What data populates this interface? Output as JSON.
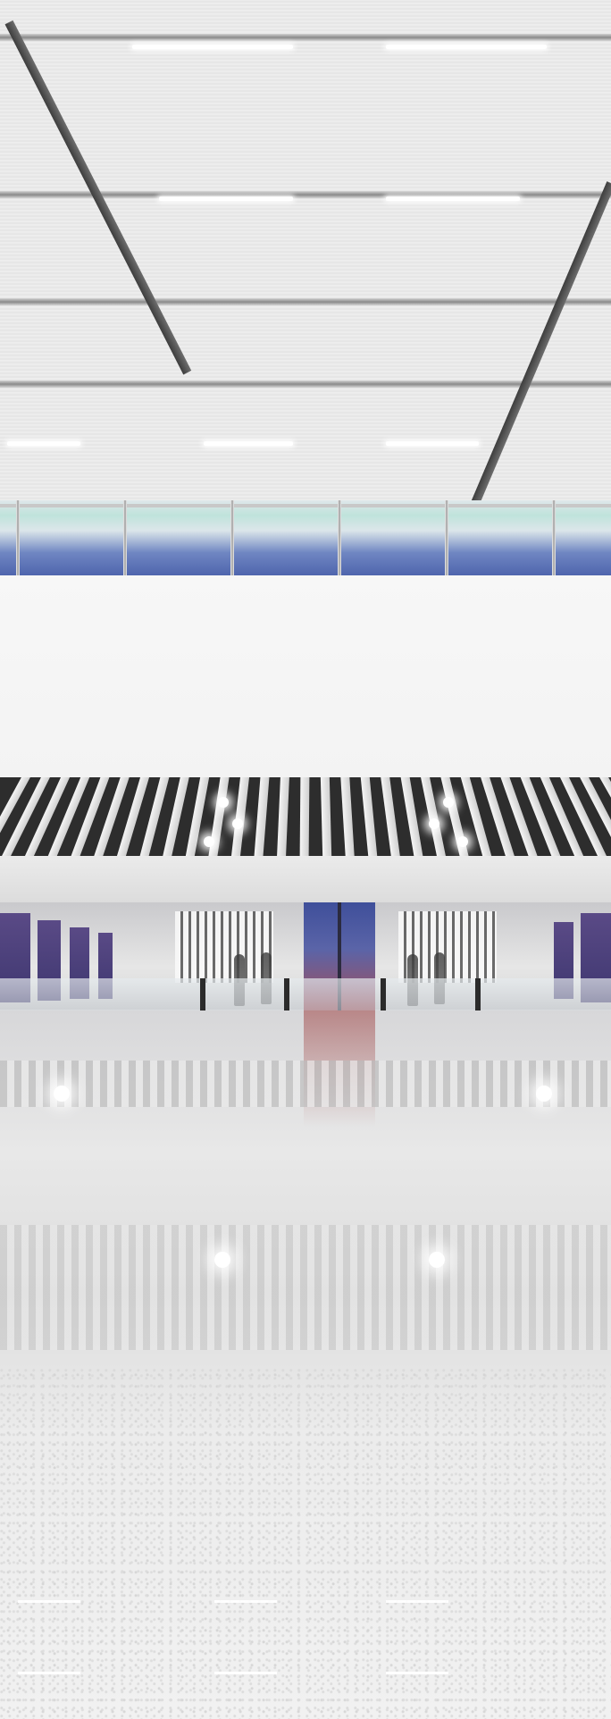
{
  "image": {
    "subject": "interior-photo",
    "palette": {
      "ceiling": "#eeeeee",
      "beam": "#4a4a4a",
      "rail_glass": "#bfe3db",
      "blue_trim": "#4f65ad",
      "wall": "#f5f5f5",
      "purple_panels": "#4a3e7a",
      "red_doorway": "#b24a4a",
      "floor": "#e4e4e4"
    }
  }
}
